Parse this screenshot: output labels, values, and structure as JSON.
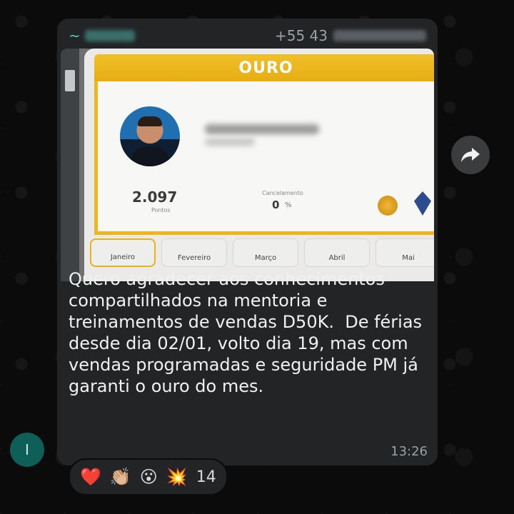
{
  "sender": {
    "prefix": "~",
    "phone_prefix": "+55 43"
  },
  "media": {
    "level_label": "OURO",
    "points_value": "2.097",
    "points_label": "Pontos",
    "cancel_label": "Cancelamento",
    "cancel_value": "0",
    "cancel_unit": "%",
    "months": [
      "Janeiro",
      "Fevereiro",
      "Março",
      "Abril",
      "Mai"
    ]
  },
  "message": {
    "text": "Quero agradecer aos conhecimentos compartilhados na mentoria e treinamentos de vendas D50K.  De férias desde dia 02/01, volto dia 19, mas com vendas programadas e seguridade PM já garanti o ouro do mes.",
    "time": "13:26"
  },
  "avatar_initial": "I",
  "reactions": {
    "emojis": [
      "❤️",
      "👏🏼",
      "😮",
      "💥"
    ],
    "count": "14"
  },
  "colors": {
    "bubble": "#222426",
    "sender_name": "#4dd2c4",
    "gold": "#efb51c"
  }
}
